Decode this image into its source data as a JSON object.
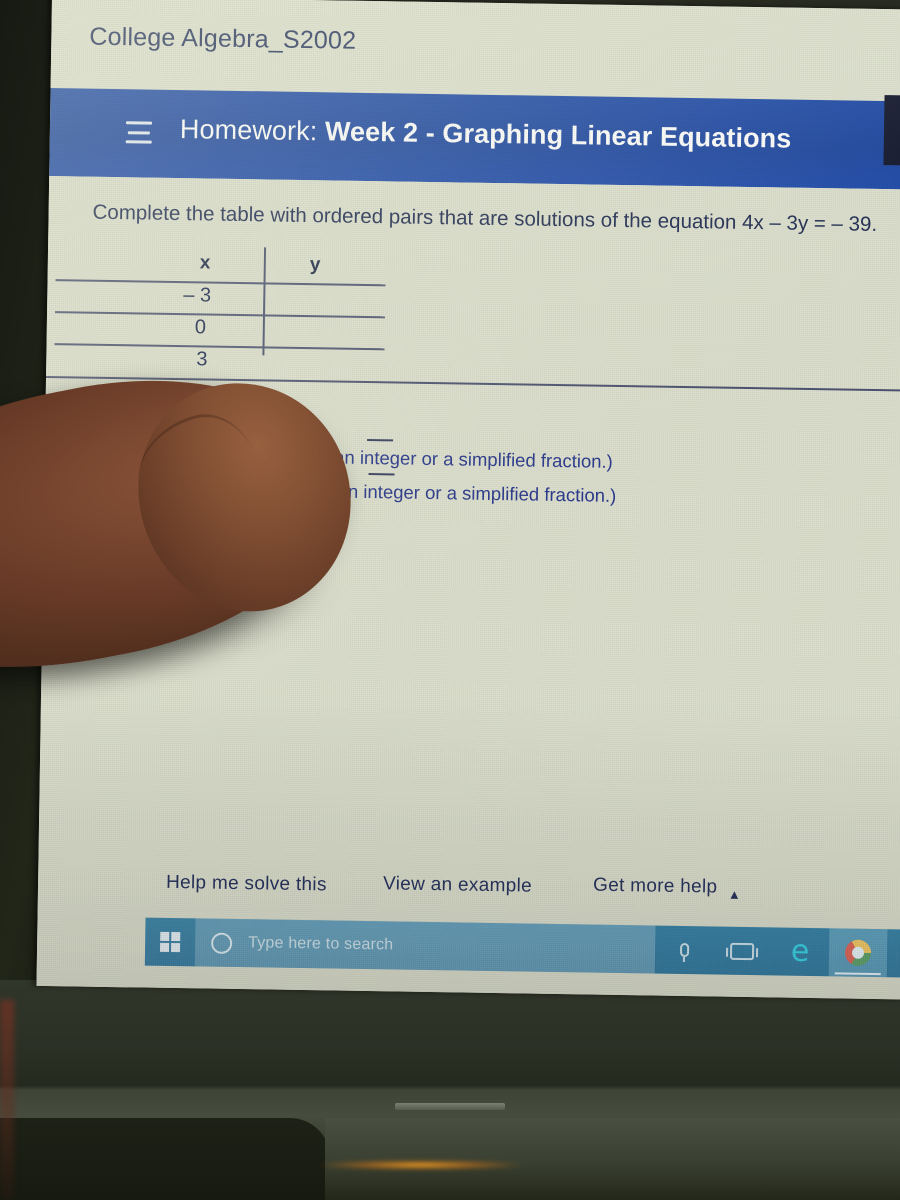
{
  "course": {
    "title": "College Algebra_S2002"
  },
  "appbar": {
    "menu_icon": "hamburger-menu-icon",
    "label_prefix": "Homework:",
    "assignment_name": "Week 2 - Graphing Linear Equations",
    "background_color": "#1a44a0",
    "text_color": "#ffffff"
  },
  "problem": {
    "prompt": "Complete the table with ordered pairs that are solutions of the equation 4x – 3y = – 39.",
    "equation": "4x – 3y = – 39"
  },
  "table": {
    "headers": [
      "x",
      "y"
    ],
    "rows": [
      {
        "x": "– 3",
        "y": ""
      },
      {
        "x": "0",
        "y": ""
      },
      {
        "x": "3",
        "y": ""
      }
    ]
  },
  "hints": [
    "(Type an integer or a simplified fraction.)",
    "(Type an integer or a simplified fraction.)"
  ],
  "actions": {
    "help_me_solve_this": "Help me solve this",
    "view_an_example": "View an example",
    "get_more_help": "Get more help",
    "get_more_help_caret": "▲"
  },
  "taskbar": {
    "start_icon": "windows-start-icon",
    "cortana_icon": "cortana-circle-icon",
    "search_placeholder": "Type here to search",
    "icons": [
      {
        "name": "microphone-icon",
        "active": false
      },
      {
        "name": "task-view-icon",
        "active": false
      },
      {
        "name": "edge-browser-icon",
        "glyph": "e",
        "active": false
      },
      {
        "name": "chrome-browser-icon",
        "active": true
      },
      {
        "name": "file-explorer-icon",
        "active": false
      }
    ],
    "background_color": "#2b76a0"
  },
  "screen": {
    "page_background": "#dde0ce",
    "link_text_color": "#2b3a8e",
    "body_text_color": "#1e2a52"
  },
  "photo": {
    "obstruction": "finger-over-screen",
    "device": "laptop"
  }
}
